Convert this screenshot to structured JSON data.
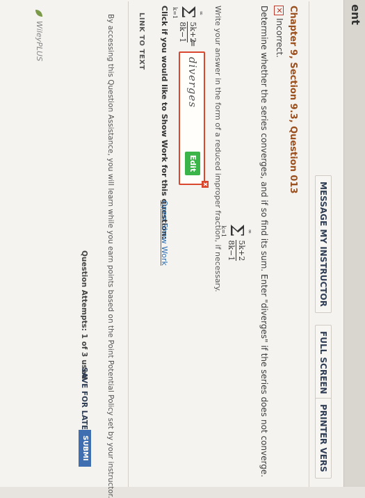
{
  "window": {
    "title_fragment": "ent"
  },
  "toolbar": {
    "message_label": "MESSAGE MY INSTRUCTOR",
    "fullscreen_label": "FULL SCREEN",
    "print_label": "PRINTER VERS"
  },
  "question": {
    "chapter": "Chapter 9, Section 9.3, Question 013",
    "status": "Incorrect.",
    "prompt": "Determine whether the series converges, and if so find its sum. Enter \"diverges\" if the series does not converge.",
    "series_upper": "∞",
    "series_lower": "k=1",
    "series_numerator": "5k+2",
    "series_denominator": "8k−1",
    "instruction": "Write your answer in the form of a reduced improper fraction, if necessary.",
    "answer_value": "diverges",
    "edit_label": "Edit",
    "clear_label": "x",
    "equals": "="
  },
  "show_work": {
    "prompt": "Click if you would like to Show Work for this question:",
    "link": "Open Show Work"
  },
  "link_to_text": "LINK TO TEXT",
  "assistance_note": "By accessing this Question Assistance, you will learn while you earn points based on the Point Potential Policy set by your instructor.",
  "footer": {
    "attempts": "Question Attempts: 1 of 3 used",
    "save_label": "SAVE FOR LATER",
    "submit_label": "SUBMI",
    "logo_text": "WileyPLUS"
  },
  "colors": {
    "chapter_title": "#9a4f1e",
    "answer_border": "#d9472e",
    "edit_button": "#3bb54a",
    "link": "#2b6cb0",
    "submit_button": "#3f6fb0"
  }
}
